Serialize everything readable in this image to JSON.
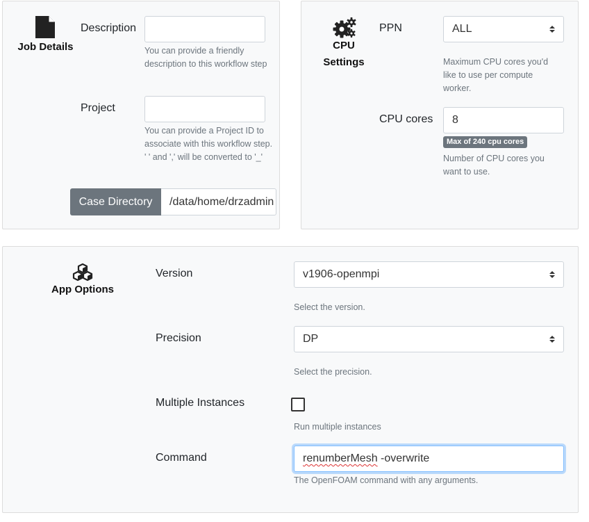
{
  "job_details": {
    "heading": "Job Details",
    "description_label": "Description",
    "description_value": "",
    "description_help": "You can provide a friendly description to this workflow step",
    "project_label": "Project",
    "project_value": "",
    "project_help": "You can provide a Project ID to associate with this workflow step. ' ' and ',' will be converted to '_'",
    "case_directory_label": "Case Directory",
    "case_directory_value": "/data/home/drzadmin"
  },
  "cpu_settings": {
    "heading_line1": "CPU",
    "heading_line2": "Settings",
    "ppn_label": "PPN",
    "ppn_value": "ALL",
    "ppn_help": "Maximum CPU cores you'd like to use per compute worker.",
    "cpu_cores_label": "CPU cores",
    "cpu_cores_value": "8",
    "cpu_cores_badge": "Max of 240 cpu cores",
    "cpu_cores_help": "Number of CPU cores you want to use."
  },
  "app_options": {
    "heading": "App Options",
    "version_label": "Version",
    "version_value": "v1906-openmpi",
    "version_help": "Select the version.",
    "precision_label": "Precision",
    "precision_value": "DP",
    "precision_help": "Select the precision.",
    "multiple_instances_label": "Multiple Instances",
    "multiple_instances_checked": false,
    "multiple_instances_help": "Run multiple instances",
    "command_label": "Command",
    "command_value_word1": "renumberMesh",
    "command_value_rest": " -overwrite",
    "command_help": "The OpenFOAM command with any arguments."
  },
  "icons": {
    "job_details": "document-icon",
    "cpu_settings": "gears-icon",
    "app_options": "cubes-icon"
  },
  "colors": {
    "panel_bg": "#f8f9fa",
    "secondary": "#6c757d",
    "focus": "#80bdff"
  }
}
